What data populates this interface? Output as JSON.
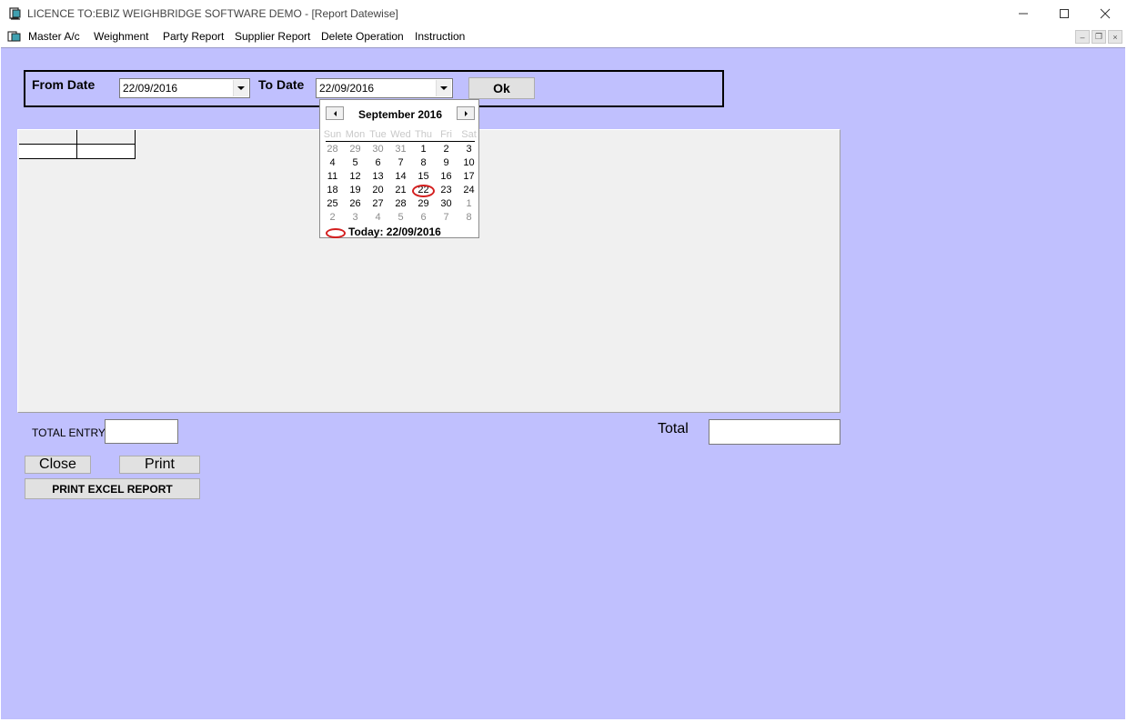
{
  "window": {
    "title": "LICENCE TO:EBIZ WEIGHBRIDGE SOFTWARE DEMO - [Report Datewise]",
    "icon": "app-document-icon"
  },
  "menu": {
    "items": [
      "Master A/c",
      "Weighment",
      "Party Report",
      "Supplier Report",
      "Delete Operation",
      "Instruction"
    ]
  },
  "filter": {
    "from_label": "From Date",
    "from_value": "22/09/2016",
    "to_label": "To Date",
    "to_value": "22/09/2016",
    "ok_label": "Ok"
  },
  "calendar": {
    "month_title": "September 2016",
    "weekdays": [
      "Sun",
      "Mon",
      "Tue",
      "Wed",
      "Thu",
      "Fri",
      "Sat"
    ],
    "weeks": [
      [
        "28",
        "29",
        "30",
        "31",
        "1",
        "2",
        "3"
      ],
      [
        "4",
        "5",
        "6",
        "7",
        "8",
        "9",
        "10"
      ],
      [
        "11",
        "12",
        "13",
        "14",
        "15",
        "16",
        "17"
      ],
      [
        "18",
        "19",
        "20",
        "21",
        "22",
        "23",
        "24"
      ],
      [
        "25",
        "26",
        "27",
        "28",
        "29",
        "30",
        "1"
      ],
      [
        "2",
        "3",
        "4",
        "5",
        "6",
        "7",
        "8"
      ]
    ],
    "selected_day": "22",
    "today_text": "Today: 22/09/2016"
  },
  "footer": {
    "total_entry_label": "TOTAL ENTRY",
    "total_entry_value": "",
    "total_label": "Total",
    "total_value": "",
    "close_label": "Close",
    "print_label": "Print",
    "excel_label": "PRINT EXCEL REPORT"
  },
  "colors": {
    "client_bg": "#c0c0fe",
    "button_bg": "#e1e1e1",
    "highlight_ring": "#d42020"
  }
}
